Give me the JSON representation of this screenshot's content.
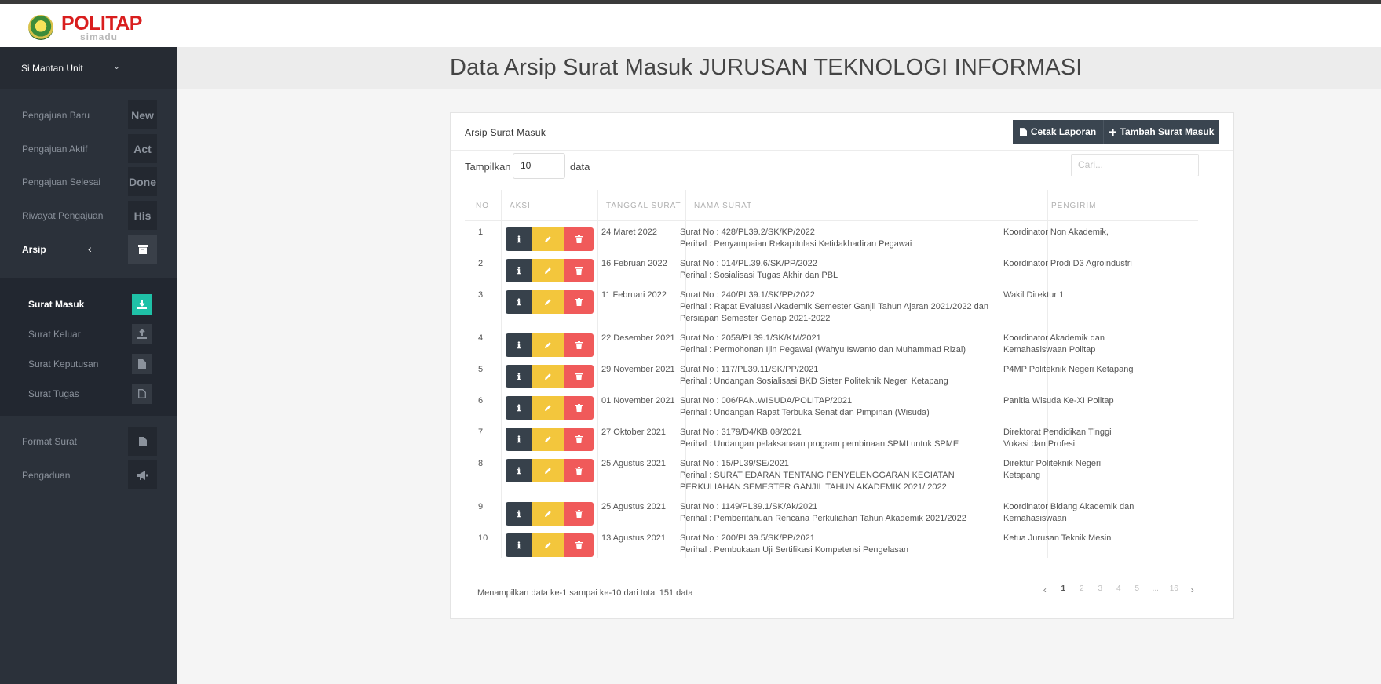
{
  "brand": {
    "name": "POLITAP",
    "sub": "simadu"
  },
  "sidebar": {
    "unit_label": "Si Mantan Unit",
    "items": [
      {
        "label": "Pengajuan Baru",
        "badge": "New"
      },
      {
        "label": "Pengajuan Aktif",
        "badge": "Act"
      },
      {
        "label": "Pengajuan Selesai",
        "badge": "Done"
      },
      {
        "label": "Riwayat Pengajuan",
        "badge": "His"
      },
      {
        "label": "Arsip",
        "icon": "archive-icon"
      }
    ],
    "arsip_sub": [
      {
        "label": "Surat Masuk",
        "icon": "download-icon"
      },
      {
        "label": "Surat Keluar",
        "icon": "upload-icon"
      },
      {
        "label": "Surat Keputusan",
        "icon": "file-icon"
      },
      {
        "label": "Surat Tugas",
        "icon": "file-outline-icon"
      }
    ],
    "bottom": [
      {
        "label": "Format Surat",
        "icon": "file-icon"
      },
      {
        "label": "Pengaduan",
        "icon": "megaphone-icon"
      }
    ]
  },
  "page": {
    "title": "Data Arsip Surat Masuk JURUSAN TEKNOLOGI INFORMASI"
  },
  "panel": {
    "title": "Arsip Surat Masuk",
    "print_label": "Cetak Laporan",
    "add_label": "Tambah Surat Masuk",
    "show_label": "Tampilkan",
    "show_value": "10",
    "show_after": "data",
    "search_placeholder": "Cari..."
  },
  "table": {
    "headers": [
      "NO",
      "AKSI",
      "TANGGAL SURAT",
      "NAMA SURAT",
      "PENGIRIM"
    ],
    "rows": [
      {
        "no": "1",
        "tanggal": "24 Maret 2022",
        "nomor": "Surat No : 428/PL39.2/SK/KP/2022",
        "perihal": "Perihal : Penyampaian Rekapitulasi Ketidakhadiran Pegawai",
        "pengirim": "Koordinator Non Akademik,"
      },
      {
        "no": "2",
        "tanggal": "16 Februari 2022",
        "nomor": "Surat No : 014/PL.39.6/SK/PP/2022",
        "perihal": "Perihal : Sosialisasi Tugas Akhir dan PBL",
        "pengirim": "Koordinator Prodi D3 Agroindustri"
      },
      {
        "no": "3",
        "tanggal": "11 Februari 2022",
        "nomor": "Surat No : 240/PL39.1/SK/PP/2022",
        "perihal": "Perihal : Rapat Evaluasi Akademik Semester Ganjil Tahun Ajaran 2021/2022 dan Persiapan Semester Genap 2021-2022",
        "pengirim": "Wakil Direktur 1"
      },
      {
        "no": "4",
        "tanggal": "22 Desember 2021",
        "nomor": "Surat No : 2059/PL39.1/SK/KM/2021",
        "perihal": "Perihal : Permohonan Ijin Pegawai (Wahyu Iswanto dan Muhammad Rizal)",
        "pengirim": "Koordinator Akademik dan Kemahasiswaan Politap"
      },
      {
        "no": "5",
        "tanggal": "29 November 2021",
        "nomor": "Surat No : 117/PL39.11/SK/PP/2021",
        "perihal": "Perihal : Undangan Sosialisasi BKD Sister Politeknik Negeri Ketapang",
        "pengirim": "P4MP Politeknik Negeri Ketapang"
      },
      {
        "no": "6",
        "tanggal": "01 November 2021",
        "nomor": "Surat No : 006/PAN.WISUDA/POLITAP/2021",
        "perihal": "Perihal : Undangan Rapat Terbuka Senat dan Pimpinan (Wisuda)",
        "pengirim": "Panitia Wisuda Ke-XI Politap"
      },
      {
        "no": "7",
        "tanggal": "27 Oktober 2021",
        "nomor": "Surat No : 3179/D4/KB.08/2021",
        "perihal": "Perihal : Undangan pelaksanaan program pembinaan SPMI untuk SPME",
        "pengirim": "Direktorat Pendidikan Tinggi Vokasi dan Profesi"
      },
      {
        "no": "8",
        "tanggal": "25 Agustus 2021",
        "nomor": "Surat No : 15/PL39/SE/2021",
        "perihal": "Perihal : SURAT EDARAN TENTANG PENYELENGGARAN KEGIATAN PERKULIAHAN SEMESTER GANJIL TAHUN AKADEMIK 2021/ 2022",
        "pengirim": "Direktur Politeknik Negeri Ketapang"
      },
      {
        "no": "9",
        "tanggal": "25 Agustus 2021",
        "nomor": "Surat No : 1149/PL39.1/SK/Ak/2021",
        "perihal": "Perihal : Pemberitahuan Rencana Perkuliahan Tahun Akademik 2021/2022",
        "pengirim": "Koordinator Bidang Akademik dan Kemahasiswaan"
      },
      {
        "no": "10",
        "tanggal": "13 Agustus 2021",
        "nomor": "Surat No : 200/PL39.5/SK/PP/2021",
        "perihal": "Perihal : Pembukaan Uji Sertifikasi Kompetensi Pengelasan",
        "pengirim": "Ketua Jurusan Teknik Mesin"
      }
    ]
  },
  "footer": {
    "info": "Menampilkan data ke-1 sampai ke-10 dari total 151 data",
    "pages": [
      "1",
      "2",
      "3",
      "4",
      "5",
      "...",
      "16"
    ]
  }
}
